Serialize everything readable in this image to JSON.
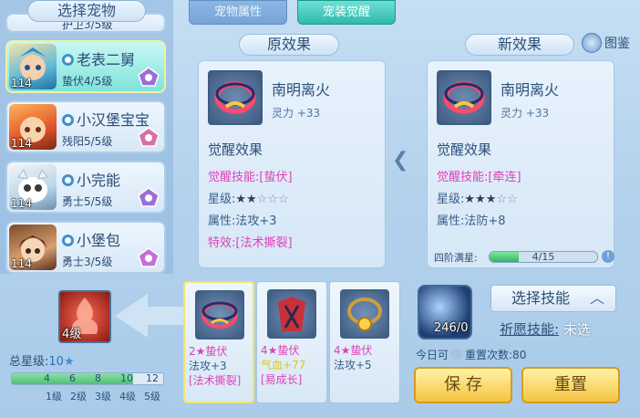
{
  "left": {
    "title": "选择宠物",
    "partial_item": {
      "rank": "护卫3/5级"
    },
    "pets": [
      {
        "name": "老表二舅",
        "rank": "蛰伏4/5级",
        "level": "114",
        "selected": true
      },
      {
        "name": "小汉堡宝宝",
        "rank": "残阳5/5级",
        "level": "114",
        "selected": false
      },
      {
        "name": "小完能",
        "rank": "勇士5/5级",
        "level": "114",
        "selected": false
      },
      {
        "name": "小堡包",
        "rank": "勇士3/5级",
        "level": "114",
        "selected": false
      }
    ]
  },
  "tabs": [
    {
      "label": "宠物属性"
    },
    {
      "label": "宠装觉醒"
    }
  ],
  "original": {
    "header": "原效果",
    "equip_name": "南明离火",
    "equip_stat": "灵力 +33",
    "effect_title": "觉醒效果",
    "skill_label": "觉醒技能:",
    "skill_value": "[蛰伏]",
    "star_label": "星级:",
    "stars_filled": 2,
    "stars_total": 5,
    "attr_label": "属性:",
    "attr_value": "法攻+3",
    "special_label": "特效:",
    "special_value": "[法术撕裂]"
  },
  "new": {
    "header": "新效果",
    "tujian": "图鉴",
    "equip_name": "南明离火",
    "equip_stat": "灵力 +33",
    "effect_title": "觉醒效果",
    "skill_label": "觉醒技能:",
    "skill_value": "[牵连]",
    "star_label": "星级:",
    "stars_filled": 3,
    "stars_total": 5,
    "attr_label": "属性:",
    "attr_value": "法防+8",
    "progress_label": "四阶满星:",
    "progress_text": "4/15",
    "progress_fraction": 0.27
  },
  "bottom_left": {
    "icon_level": "4级",
    "total_star_label": "总星级:",
    "total_star_value": "10",
    "level_nums": [
      "4",
      "6",
      "8",
      "10",
      "12"
    ],
    "level_labels": [
      "1级",
      "2级",
      "3级",
      "4级",
      "5级"
    ],
    "fill_fraction": 0.8
  },
  "options": [
    {
      "line1": "2★蛰伏",
      "line2": "法攻+3",
      "line3": "[法术撕裂]",
      "selected": true
    },
    {
      "line1": "4★蛰伏",
      "line2": "气血+77",
      "line3": "[易成长]",
      "selected": false
    },
    {
      "line1": "4★蛰伏",
      "line2": "法攻+5",
      "line3": "",
      "selected": false
    }
  ],
  "right": {
    "orb_count": "246/0",
    "select_skill": "选择技能",
    "wish_label": "祈愿技能:",
    "wish_value": "未选",
    "reset_prefix": "今日可",
    "reset_text": "重置次数:80",
    "save_button": "保 存",
    "reset_button": "重置"
  },
  "colors": {
    "accent_pink": "#e040b8",
    "tab_active": "#2fb9ad",
    "button_yellow": "#f5c440"
  }
}
